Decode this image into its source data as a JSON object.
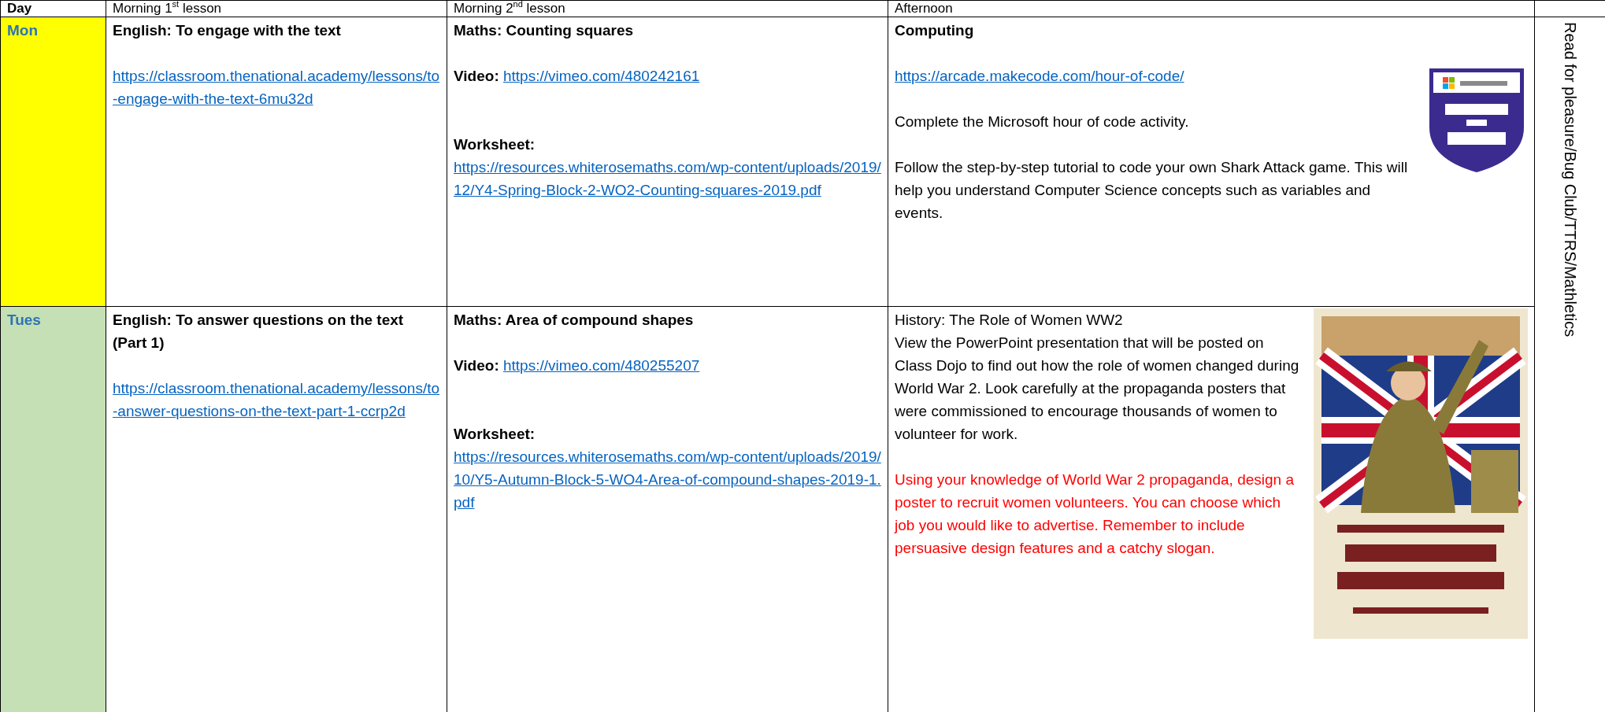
{
  "table": {
    "columns": [
      "Day",
      "Morning 1$^{st}$ lesson",
      "Morning 2$^{nd}$ lesson",
      "Afternoon"
    ],
    "side_note": "Read for pleasure/Bug Club/TTRS/Mathletics",
    "rows": [
      {
        "day": "Mon",
        "color": "#ffff00",
        "lessons": [
          [
            {
              "kind": "heading",
              "text": "English: To engage with the text"
            },
            {
              "kind": "link",
              "url": "https://classroom.thenational.academy/lessons/to-engage-with-the-text-6mu32d"
            }
          ],
          [
            {
              "kind": "heading",
              "text": "Maths: Counting squares"
            },
            {
              "kind": "inline_link",
              "label": "Video:",
              "url": "https://vimeo.com/480242161"
            },
            {
              "kind": "block_link",
              "label": "Worksheet:",
              "url": "https://resources.whiterosemaths.com/wp-content/uploads/2019/12/Y4-Spring-Block-2-WO2-Counting-squares-2019.pdf"
            }
          ],
          [
            {
              "kind": "heading",
              "text": "Computing"
            },
            {
              "kind": "picture"
            },
            {
              "kind": "link",
              "url": "https://arcade.makecode.com/hour-of-code/"
            },
            {
              "kind": "text",
              "text": "Complete the Microsoft hour of code activity."
            },
            {
              "kind": "text",
              "text": "Follow the step-by-step tutorial to code your own Shark Attack game. This will help you understand Computer Science concepts such as variables and events."
            }
          ]
        ]
      },
      {
        "day": "Tues",
        "color": "#c5e0b4",
        "lessons": [
          [
            {
              "kind": "heading",
              "text": "English: To answer questions on the text (Part 1)"
            },
            {
              "kind": "link",
              "url": "https://classroom.thenational.academy/lessons/to-answer-questions-on-the-text-part-1-ccrp2d"
            }
          ],
          [
            {
              "kind": "heading",
              "text": "Maths: Area of compound shapes"
            },
            {
              "kind": "inline_link",
              "label": "Video:",
              "url": "https://vimeo.com/480255207"
            },
            {
              "kind": "block_link",
              "label": "Worksheet:",
              "url": "https://resources.whiterosemaths.com/wp-content/uploads/2019/10/Y5-Autumn-Block-5-WO4-Area-of-compound-shapes-2019-1.pdf"
            }
          ],
          [
            {
              "kind": "picture"
            },
            {
              "kind": "title",
              "text": "History: The Role of Women WW2"
            },
            {
              "kind": "text",
              "text": "View the PowerPoint presentation that will be posted on Class Dojo to find out how the role of women changed during World War 2. Look carefully at the propaganda posters that were commissioned to encourage thousands of women to volunteer for work."
            },
            {
              "kind": "note",
              "text": "Using your knowledge of World War 2 propaganda, design a poster to recruit women volunteers. You can choose which job you would like to advertise. Remember to include persuasive design features and a catchy slogan."
            }
          ]
        ]
      }
    ]
  }
}
